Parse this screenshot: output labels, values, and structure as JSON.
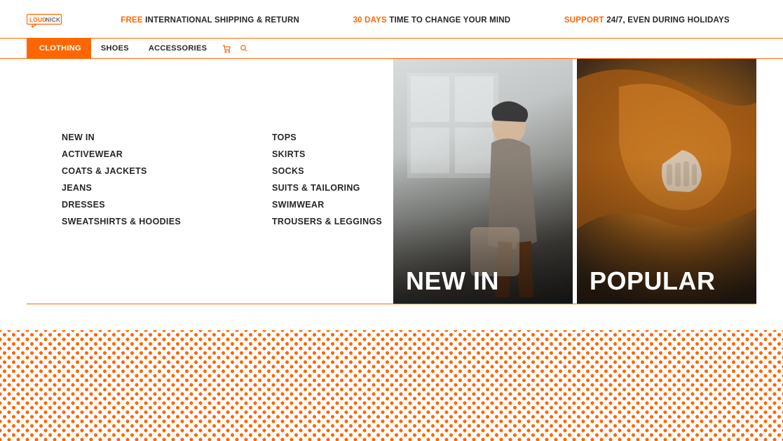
{
  "brand": {
    "name": "LOUDNICK"
  },
  "promos": [
    {
      "accent": "FREE",
      "rest": " INTERNATIONAL SHIPPING & RETURN"
    },
    {
      "accent": "30 DAYS",
      "rest": " TIME TO CHANGE YOUR MIND"
    },
    {
      "accent": "SUPPORT",
      "rest": " 24/7, EVEN DURING HOLIDAYS"
    }
  ],
  "nav": {
    "items": [
      {
        "label": "CLOTHING",
        "active": true
      },
      {
        "label": "SHOES",
        "active": false
      },
      {
        "label": "ACCESSORIES",
        "active": false
      }
    ]
  },
  "mega": {
    "col1": [
      "NEW IN",
      "ACTIVEWEAR",
      "COATS & JACKETS",
      "JEANS",
      "DRESSES",
      "SWEATSHIRTS & HOODIES"
    ],
    "col2": [
      "TOPS",
      "SKIRTS",
      "SOCKS",
      "SUITS & TAILORING",
      "SWIMWEAR",
      "TROUSERS & LEGGINGS"
    ],
    "tiles": [
      {
        "label": "NEW IN"
      },
      {
        "label": "POPULAR"
      }
    ]
  }
}
